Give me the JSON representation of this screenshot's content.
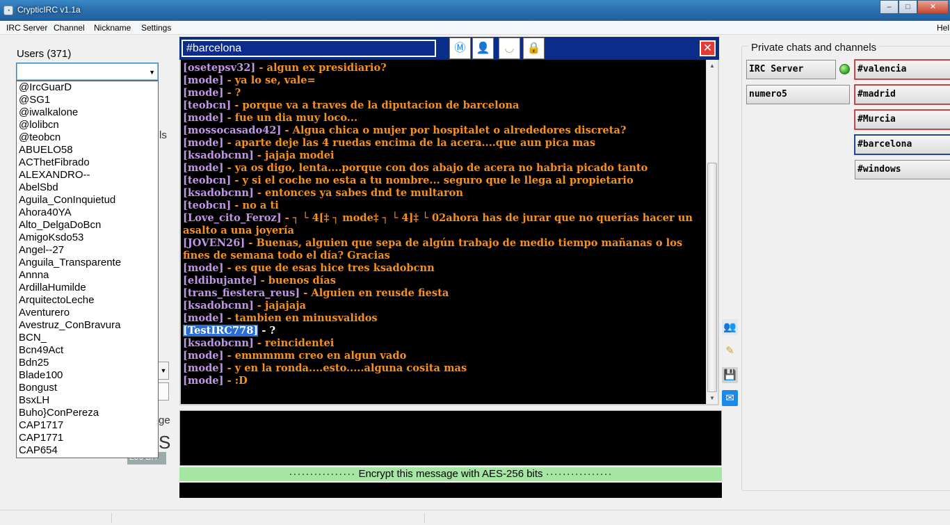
{
  "window": {
    "title": "CrypticIRC v1.1a",
    "minimize": "–",
    "maximize": "□",
    "close": "✕"
  },
  "menu": {
    "items": [
      "IRC Server",
      "Channel",
      "Nickname",
      "Settings"
    ],
    "help": "Hel"
  },
  "users": {
    "label": "Users (371)",
    "list": [
      "@IrcGuarD",
      "@SG1",
      "@iwalkalone",
      "@lolibcn",
      "@teobcn",
      "ABUELO58",
      "ACThetFibrado",
      "ALEXANDRO--",
      "AbelSbd",
      "Aguila_ConInquietud",
      "Ahora40YA",
      "Alto_DelgaDoBcn",
      "AmigoKsdo53",
      "Angel--27",
      "Anguila_Transparente",
      "Annna",
      "ArdillaHumilde",
      "ArquitectoLeche",
      "Aventurero",
      "Avestruz_ConBravura",
      "BCN_",
      "Bcn49Act",
      "Bdn25",
      "Blade100",
      "Bongust",
      "BsxLH",
      "Buho}ConPereza",
      "CAP1717",
      "CAP1771",
      "CAP654"
    ]
  },
  "behind": {
    "text_ls": "ls",
    "text_ge": "ge",
    "text_s": "S",
    "text_256": "256 BIT"
  },
  "channel": {
    "name": "#barcelona",
    "close_label": "✕"
  },
  "toolbar_icons": [
    "mirc-icon",
    "user-icon",
    "eye-icon",
    "lock-icon"
  ],
  "chat": [
    {
      "nick": "[osetepsv32]",
      "msg": " - algun ex presidiario?"
    },
    {
      "nick": "[mode]",
      "msg": " - ya lo se, vale="
    },
    {
      "nick": "[mode]",
      "msg": " - ?"
    },
    {
      "nick": "[teobcn]",
      "msg": " - porque va a traves de la diputacion de barcelona"
    },
    {
      "nick": "[mode]",
      "msg": " - fue un dia muy loco..."
    },
    {
      "nick": "[mossocasado42]",
      "msg": " - Algua chica o mujer por hospitalet o alrededores discreta?"
    },
    {
      "nick": "[mode]",
      "msg": " - aparte deje las 4 ruedas encima de la acera....que aun pica mas"
    },
    {
      "nick": "[ksadobcnn]",
      "msg": " - jajaja modei"
    },
    {
      "nick": "[mode]",
      "msg": " - ya os digo, lenta....porque con dos abajo de acera no habria picado tanto"
    },
    {
      "nick": "[teobcn]",
      "msg": " - y si el coche no esta a tu nombre... seguro que le llega al propietario"
    },
    {
      "nick": "[ksadobcnn]",
      "msg": " - entonces ya sabes dnd te multaron"
    },
    {
      "nick": "[teobcn]",
      "msg": " - no a ti"
    },
    {
      "nick": "[Love_cito_Feroz]",
      "msg": " - ┐ └ 4[‡ ┐ mode‡ ┐ └ 4]‡ └ 02ahora has de jurar que no querías hacer un asalto a una joyería"
    },
    {
      "nick": "[JOVEN26]",
      "msg": " - Buenas, alguien que sepa de algún trabajo de medio tiempo mañanas o los fines de semana todo el día? Gracias"
    },
    {
      "nick": "[mode]",
      "msg": " - es que de esas hice tres ksadobcnn"
    },
    {
      "nick": "[eldibujante]",
      "msg": " - buenos días"
    },
    {
      "nick": "[trans_fiestera_reus]",
      "msg": " - Alguien en reusde fiesta"
    },
    {
      "nick": "[ksadobcnn]",
      "msg": " - jajajaja"
    },
    {
      "nick": "[mode]",
      "msg": " - tambien en minusvalidos"
    },
    {
      "nick": "[TestIRC778]",
      "msg": " - ?",
      "self": true
    },
    {
      "nick": "[ksadobcnn]",
      "msg": " - reincidentei"
    },
    {
      "nick": "[mode]",
      "msg": " - emmmmm creo en algun vado"
    },
    {
      "nick": "[mode]",
      "msg": " - y en la ronda....esto.....alguna cosita mas"
    },
    {
      "nick": "[mode]",
      "msg": " - :D"
    }
  ],
  "encrypt": {
    "dots_left": "················",
    "label": "Encrypt this message with AES-256 bits",
    "dots_right": "················"
  },
  "private": {
    "label": "Private chats and channels",
    "server": "IRC Server",
    "nick": "numero5",
    "channels": [
      "#valencia",
      "#madrid",
      "#Murcia",
      "#barcelona",
      "#windows"
    ]
  },
  "colors": {
    "nick": "#c196e5",
    "message": "#f6911e",
    "header": "#0a2d8a",
    "encrypt_bar": "#a6e6a3"
  }
}
